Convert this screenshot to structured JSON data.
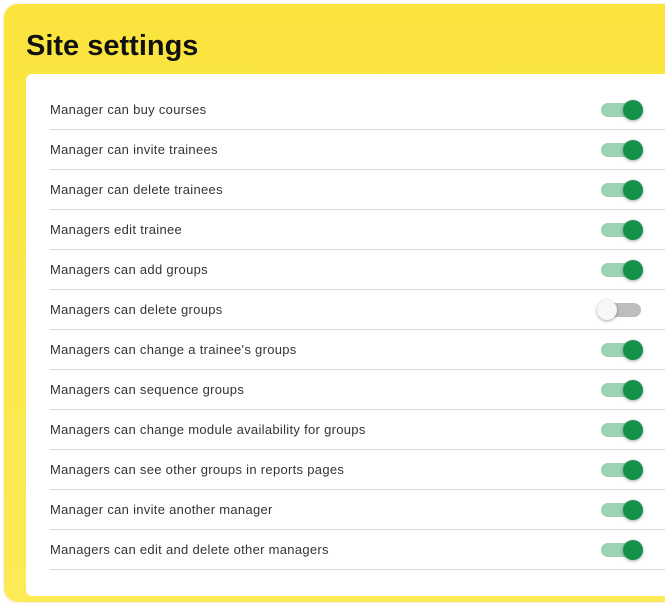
{
  "title": "Site settings",
  "colors": {
    "panel_background": "#fbe43e",
    "toggle_on_knob": "#14924a",
    "toggle_on_track": "#9bd3b3",
    "toggle_off_knob": "#f7f7f7",
    "toggle_off_track": "#bdbdbd"
  },
  "settings": [
    {
      "label": "Manager can buy courses",
      "enabled": true
    },
    {
      "label": "Manager can invite trainees",
      "enabled": true
    },
    {
      "label": "Manager can delete trainees",
      "enabled": true
    },
    {
      "label": "Managers edit trainee",
      "enabled": true
    },
    {
      "label": "Managers can add groups",
      "enabled": true
    },
    {
      "label": "Managers can delete groups",
      "enabled": false
    },
    {
      "label": "Managers can change a trainee's groups",
      "enabled": true
    },
    {
      "label": "Managers can sequence groups",
      "enabled": true
    },
    {
      "label": "Managers can change module availability for groups",
      "enabled": true
    },
    {
      "label": "Managers can see other groups in reports pages",
      "enabled": true
    },
    {
      "label": "Manager can invite another manager",
      "enabled": true
    },
    {
      "label": "Managers can edit and delete other managers",
      "enabled": true
    }
  ]
}
